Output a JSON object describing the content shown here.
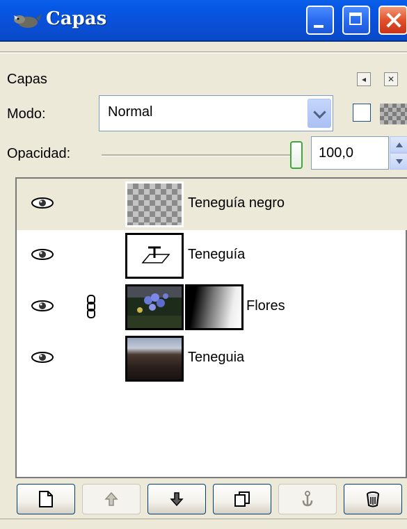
{
  "window": {
    "title": "Capas"
  },
  "dock": {
    "title": "Capas"
  },
  "mode": {
    "label": "Modo:",
    "value": "Normal"
  },
  "opacity": {
    "label": "Opacidad:",
    "value": "100,0"
  },
  "layers": [
    {
      "name": "Teneguía negro",
      "visible": true,
      "linked": false,
      "selected": true,
      "thumbnail": "transparent-checker"
    },
    {
      "name": "Teneguía",
      "visible": true,
      "linked": false,
      "selected": false,
      "thumbnail": "text-layer"
    },
    {
      "name": "Flores",
      "visible": true,
      "linked": true,
      "selected": false,
      "thumbnail": "flowers-photo",
      "has_mask": true
    },
    {
      "name": "Teneguia",
      "visible": true,
      "linked": false,
      "selected": false,
      "thumbnail": "landscape-photo"
    }
  ],
  "buttons": [
    {
      "icon": "new-layer-icon",
      "enabled": true
    },
    {
      "icon": "raise-layer-icon",
      "enabled": false
    },
    {
      "icon": "lower-layer-icon",
      "enabled": true
    },
    {
      "icon": "duplicate-layer-icon",
      "enabled": true
    },
    {
      "icon": "anchor-layer-icon",
      "enabled": false
    },
    {
      "icon": "delete-layer-icon",
      "enabled": true
    }
  ],
  "colors": {
    "titlebar": "#0a4fd6",
    "selected_row": "#ece9d8",
    "slider_thumb": "#3ea63c"
  }
}
